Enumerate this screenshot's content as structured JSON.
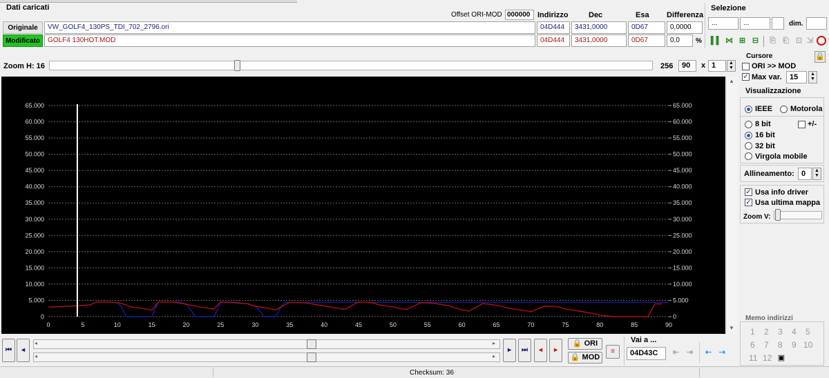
{
  "header": {
    "section_title": "Dati caricati",
    "offset_label": "Offset ORI-MOD",
    "offset_value": "000000",
    "col_indirizzo": "Indirizzo",
    "col_dec": "Dec",
    "col_esa": "Esa",
    "col_diff": "Differenza"
  },
  "files": {
    "ori_label": "Originale",
    "ori_name": "VW_GOLF4_130PS_TDI_702_2796.ori",
    "ori_addr": "04D444",
    "ori_dec": "3431,0000",
    "ori_hex": "0D67",
    "ori_diff": "0,0000",
    "mod_label": "Modificato",
    "mod_name": "GOLF4 130HOT.MOD",
    "mod_addr": "04D444",
    "mod_dec": "3431,0000",
    "mod_hex": "0D67",
    "mod_diff": "0,0",
    "pct": "%"
  },
  "selection": {
    "title": "Selezione",
    "f1": "...",
    "f2": "...",
    "dim_label": "dim."
  },
  "zoom": {
    "label": "Zoom H: 16",
    "value_256": "256",
    "value_90": "90",
    "x_label": "x",
    "mult": "1"
  },
  "cursor": {
    "title": "Cursore",
    "ori_mod": "ORI >> MOD",
    "max_var": "Max var.",
    "max_var_value": "15"
  },
  "visual": {
    "title": "Visualizzazione",
    "ieee": "IEEE",
    "motorola": "Motorola",
    "bit8": "8 bit",
    "plusminus": "+/-",
    "bit16": "16 bit",
    "bit32": "32 bit",
    "float": "Virgola mobile",
    "align_label": "Allineamento:",
    "align_value": "0",
    "use_driver": "Usa info driver",
    "use_last": "Usa ultima mappa",
    "zoom_v": "Zoom V:"
  },
  "memo": {
    "title": "Memo indirizzi",
    "n1": "1",
    "n2": "2",
    "n3": "3",
    "n4": "4",
    "n5": "5",
    "n6": "6",
    "n7": "7",
    "n8": "8",
    "n9": "9",
    "n10": "10",
    "n11": "11",
    "n12": "12"
  },
  "bottom": {
    "ori_btn": "ORI",
    "mod_btn": "MOD",
    "goto_label": "Vai a ...",
    "goto_value": "04D43C",
    "checksum": "Checksum: 36"
  },
  "colors": {
    "ori": "#1a1aa8",
    "mod": "#b01010",
    "cursor": "#ffffff",
    "plot_bg": "#000000",
    "mod_label_bg": "#22c422"
  },
  "chart_data": {
    "type": "line",
    "xlim": [
      0,
      90
    ],
    "ylim": [
      0,
      65000
    ],
    "xticks": [
      "0",
      "5",
      "10",
      "15",
      "20",
      "25",
      "30",
      "35",
      "40",
      "45",
      "50",
      "55",
      "60",
      "65",
      "70",
      "75",
      "80",
      "85",
      "90"
    ],
    "yticks": [
      "0",
      "5.000",
      "10.000",
      "15.000",
      "20.000",
      "25.000",
      "30.000",
      "35.000",
      "40.000",
      "45.000",
      "50.000",
      "55.000",
      "60.000",
      "65.000"
    ],
    "grid": true,
    "cursor_x": 4.2,
    "series": [
      {
        "key": "mod",
        "x": [
          0,
          2,
          4,
          6,
          7,
          9,
          10,
          11,
          12,
          14,
          15,
          16,
          18,
          19,
          20,
          22,
          24,
          25,
          27,
          29,
          30,
          32,
          33,
          34,
          35,
          37,
          38,
          40,
          42,
          43,
          45,
          47,
          48,
          50,
          51,
          52,
          54,
          56,
          58,
          59,
          60,
          61,
          63,
          64,
          66,
          67,
          69,
          70,
          72,
          74,
          75,
          77,
          79,
          80,
          82,
          84,
          86,
          87,
          88,
          89
        ],
        "y": [
          2900,
          3100,
          3300,
          3600,
          4500,
          4500,
          4300,
          3800,
          3000,
          2400,
          2000,
          4500,
          4500,
          4200,
          3800,
          3000,
          2300,
          4500,
          4400,
          3900,
          3200,
          2500,
          2100,
          3300,
          4400,
          4300,
          4000,
          3300,
          2600,
          2200,
          4500,
          4300,
          3600,
          3000,
          2500,
          2200,
          4300,
          4100,
          3400,
          2700,
          2100,
          1700,
          4000,
          3800,
          3100,
          2500,
          1900,
          1500,
          3300,
          3000,
          2400,
          1700,
          1000,
          400,
          0,
          0,
          0,
          0,
          3900,
          3900
        ]
      },
      {
        "key": "ori",
        "x": [
          0,
          6,
          7,
          9,
          10,
          10.6,
          11.3,
          14,
          15,
          15.4,
          16,
          19,
          20,
          20.6,
          21.3,
          24,
          24.4,
          25,
          29,
          30,
          30.6,
          31.3,
          33,
          33.6,
          34.3,
          35,
          90
        ],
        "y": [
          2900,
          3600,
          4500,
          4500,
          4300,
          3000,
          0,
          0,
          0,
          2000,
          4500,
          4500,
          3800,
          2300,
          0,
          0,
          1500,
          4500,
          3900,
          3200,
          2000,
          0,
          0,
          2500,
          4400,
          4400,
          4400
        ]
      }
    ]
  }
}
